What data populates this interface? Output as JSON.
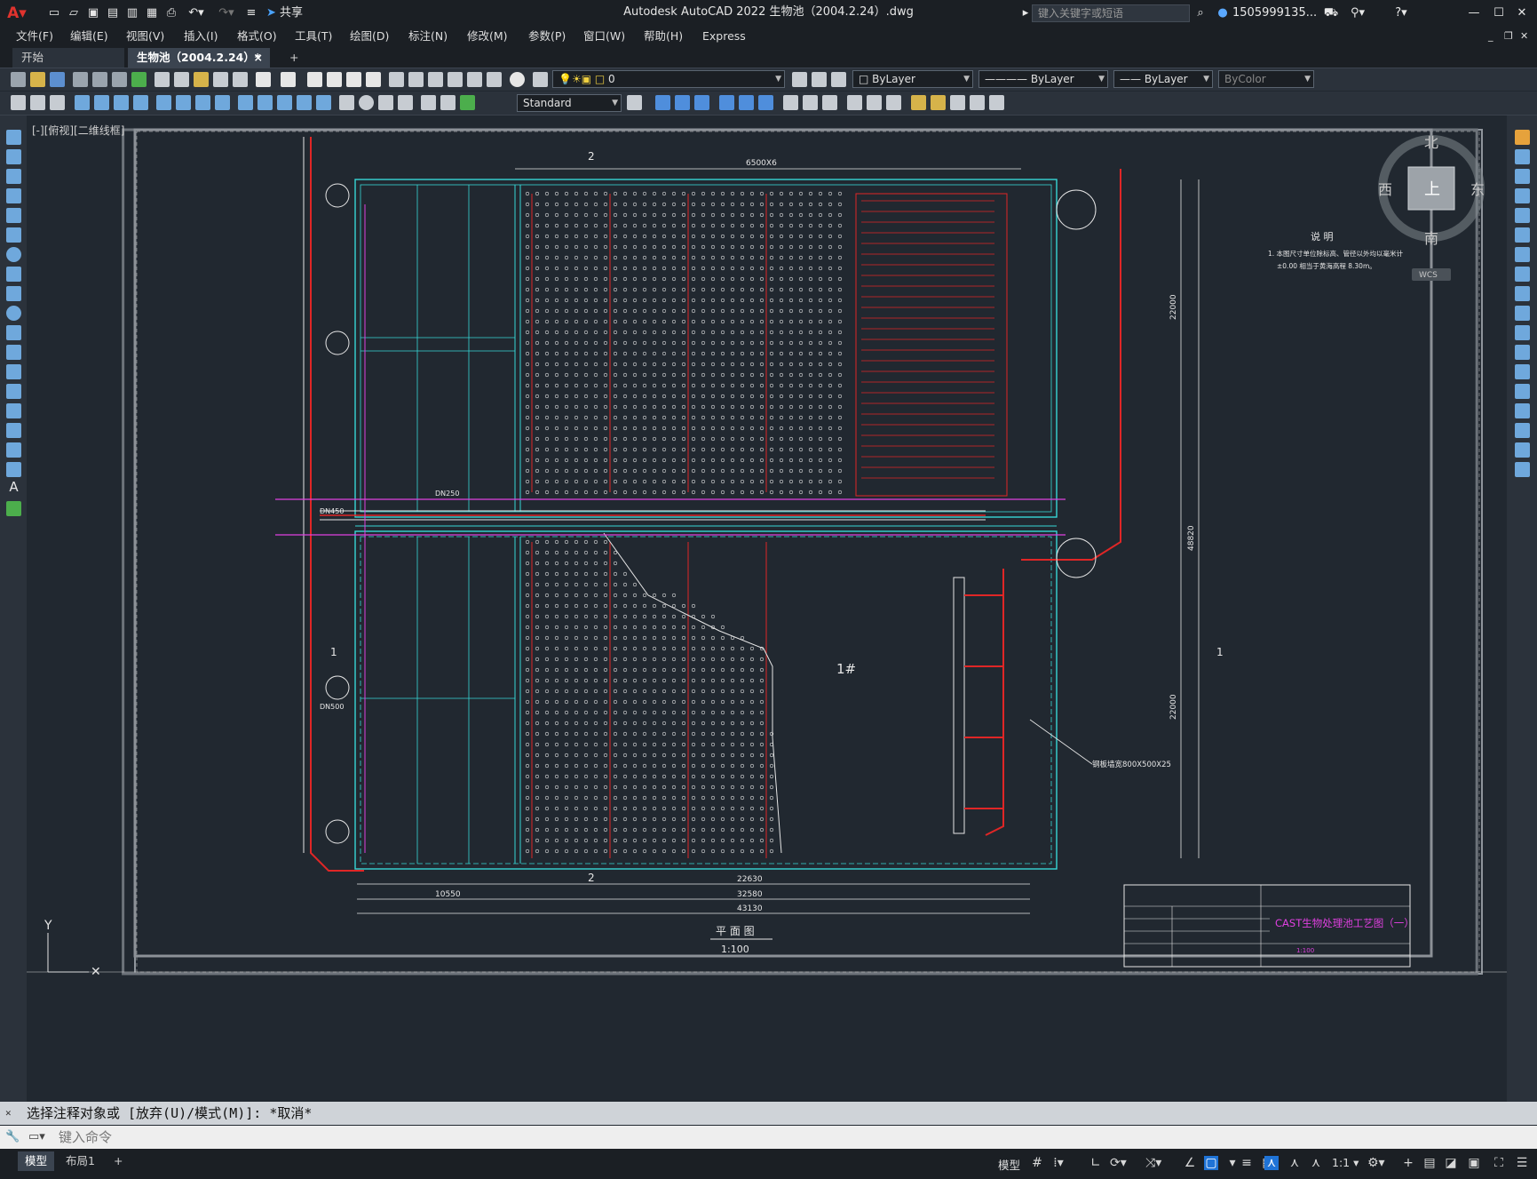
{
  "app": {
    "title": "Autodesk AutoCAD 2022    生物池（2004.2.24）.dwg",
    "search_placeholder": "键入关键字或短语",
    "user": "1505999135...",
    "share_label": "共享"
  },
  "menus": [
    "文件(F)",
    "编辑(E)",
    "视图(V)",
    "插入(I)",
    "格式(O)",
    "工具(T)",
    "绘图(D)",
    "标注(N)",
    "修改(M)",
    "参数(P)",
    "窗口(W)",
    "帮助(H)",
    "Express"
  ],
  "tabs": {
    "start": "开始",
    "active": "生物池（2004.2.24）*",
    "close": "×",
    "add": "+"
  },
  "toolbar": {
    "layer_value": "0",
    "color_value": "ByLayer",
    "linetype_value": "ByLayer",
    "lineweight_value": "ByLayer",
    "plotstyle_value": "ByColor",
    "textstyle_value": "Standard"
  },
  "viewport": {
    "label": "[-][俯视][二维线框]"
  },
  "viewcube": {
    "north": "北",
    "south": "南",
    "east": "东",
    "west": "西",
    "top": "上",
    "wcs": "WCS"
  },
  "drawing": {
    "title": "平 面 图",
    "scale": "1:100",
    "pool_label": "1#",
    "notes_title": "说 明",
    "notes_line1": "1. 本图尺寸单位除标高、管径以外均以毫米计",
    "notes_line2": "±0.00 相当于黄海高程 8.30m。",
    "titleblock_name": "CAST生物处理池工艺图（一）",
    "titleblock_scale": "1:100",
    "dim_overall": "43130",
    "dim_inner": "32580",
    "dim_sub": "22630",
    "dim_left": "10550",
    "dim_top": "6500X6",
    "dim_right": "22000",
    "dim_right2": "22000",
    "dim_right_total": "48820",
    "pipe_label1": "DN500",
    "pipe_label2": "DN450",
    "pipe_label3": "DN250",
    "callout": "钢板墙宽800X500X25",
    "section_mark": "1",
    "section_mark2": "2",
    "axis_y": "Y"
  },
  "command": {
    "history": "选择注释对象或 [放弃(U)/模式(M)]: *取消*",
    "placeholder": "键入命令"
  },
  "status": {
    "tab_model": "模型",
    "tab_layout": "布局1",
    "add": "+",
    "model_label": "模型",
    "scale_label": "1:1"
  },
  "colors": {
    "cyan": "#37d6d6",
    "red": "#e02626",
    "white": "#e6e6e6",
    "magenta": "#e040e0",
    "green": "#3fd43f",
    "accent": "#1f73d6"
  }
}
